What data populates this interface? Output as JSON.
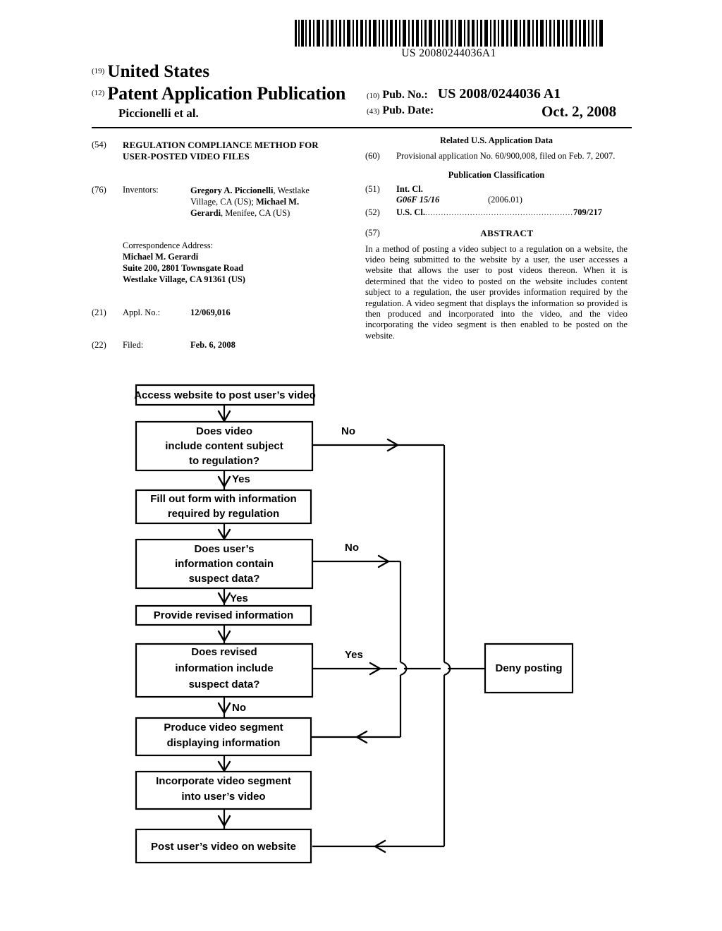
{
  "document": {
    "barcode_number": "US 20080244036A1",
    "country_code_inid": "(19)",
    "country": "United States",
    "doc_type_inid": "(12)",
    "doc_type": "Patent Application Publication",
    "authors": "Piccionelli et al.",
    "pub_no_inid": "(10)",
    "pub_no_label": "Pub. No.:",
    "pub_no_value": "US 2008/0244036 A1",
    "pub_date_inid": "(43)",
    "pub_date_label": "Pub. Date:",
    "pub_date_value": "Oct. 2, 2008"
  },
  "left_column": {
    "title": {
      "inid": "(54)",
      "line1": "REGULATION COMPLIANCE METHOD FOR",
      "line2": "USER-POSTED VIDEO FILES"
    },
    "inventors": {
      "inid": "(76)",
      "label": "Inventors:",
      "name1": "Gregory A. Piccionelli",
      "loc1": ", Westlake",
      "line2a": "Village, CA (US); ",
      "name2a": "Michael M.",
      "name2b": "Gerardi",
      "loc2": ", Menifee, CA (US)"
    },
    "correspondence": {
      "heading": "Correspondence Address:",
      "line1": "Michael M. Gerardi",
      "line2": "Suite 200, 2801 Townsgate Road",
      "line3": "Westlake Village, CA 91361 (US)"
    },
    "appl_no": {
      "inid": "(21)",
      "label": "Appl. No.:",
      "value": "12/069,016"
    },
    "filed": {
      "inid": "(22)",
      "label": "Filed:",
      "value": "Feb. 6, 2008"
    }
  },
  "right_column": {
    "related_heading": "Related U.S. Application Data",
    "related": {
      "inid": "(60)",
      "text": "Provisional application No. 60/900,008, filed on Feb. 7, 2007."
    },
    "pub_class_heading": "Publication Classification",
    "int_cl": {
      "inid": "(51)",
      "label": "Int. Cl.",
      "code": "G06F 15/16",
      "version": "(2006.01)"
    },
    "us_cl": {
      "inid": "(52)",
      "label": "U.S. Cl.",
      "dots": "........................................................",
      "value": "709/217"
    },
    "abstract": {
      "inid": "(57)",
      "heading": "ABSTRACT",
      "text": "In a method of posting a video subject to a regulation on a website, the video being submitted to the website by a user, the user accesses a website that allows the user to post videos thereon. When it is determined that the video to posted on the website includes content subject to a regulation, the user provides information required by the regulation. A video segment that displays the information so provided is then produced and incorporated into the video, and the video incorporating the video segment is then enabled to be posted on the website."
    }
  },
  "flowchart": {
    "nodes": [
      {
        "id": "access",
        "lines": [
          "Access website to post user's video"
        ]
      },
      {
        "id": "does-video",
        "lines": [
          "Does video",
          "include content subject",
          "to regulation?"
        ]
      },
      {
        "id": "fill-form",
        "lines": [
          "Fill out form with information",
          "required by regulation"
        ]
      },
      {
        "id": "user-info",
        "lines": [
          "Does user's",
          "information contain",
          "suspect data?"
        ]
      },
      {
        "id": "revised-info",
        "lines": [
          "Provide revised information"
        ]
      },
      {
        "id": "does-revised",
        "lines": [
          "Does revised",
          "information include",
          "suspect data?"
        ]
      },
      {
        "id": "produce",
        "lines": [
          "Produce video segment",
          "displaying information"
        ]
      },
      {
        "id": "incorporate",
        "lines": [
          "Incorporate video segment",
          "into user's video"
        ]
      },
      {
        "id": "post",
        "lines": [
          "Post user's video on website"
        ]
      },
      {
        "id": "deny",
        "lines": [
          "Deny posting"
        ]
      }
    ],
    "edge_labels": {
      "no1": "No",
      "yes1": "Yes",
      "no2": "No",
      "yes2": "Yes",
      "yes3": "Yes",
      "no3": "No"
    }
  }
}
